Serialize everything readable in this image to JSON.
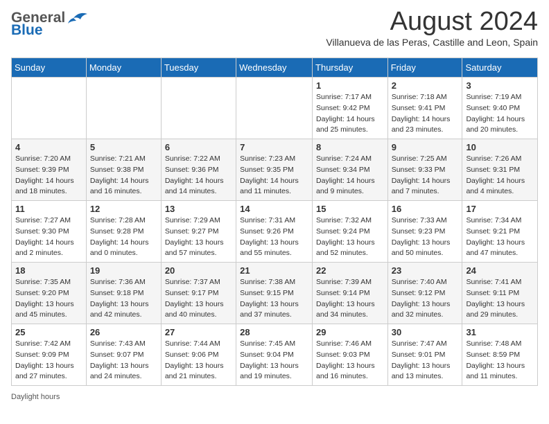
{
  "header": {
    "logo_general": "General",
    "logo_blue": "Blue",
    "month_title": "August 2024",
    "location": "Villanueva de las Peras, Castille and Leon, Spain"
  },
  "calendar": {
    "days_of_week": [
      "Sunday",
      "Monday",
      "Tuesday",
      "Wednesday",
      "Thursday",
      "Friday",
      "Saturday"
    ],
    "weeks": [
      [
        {
          "day": "",
          "info": ""
        },
        {
          "day": "",
          "info": ""
        },
        {
          "day": "",
          "info": ""
        },
        {
          "day": "",
          "info": ""
        },
        {
          "day": "1",
          "info": "Sunrise: 7:17 AM\nSunset: 9:42 PM\nDaylight: 14 hours and 25 minutes."
        },
        {
          "day": "2",
          "info": "Sunrise: 7:18 AM\nSunset: 9:41 PM\nDaylight: 14 hours and 23 minutes."
        },
        {
          "day": "3",
          "info": "Sunrise: 7:19 AM\nSunset: 9:40 PM\nDaylight: 14 hours and 20 minutes."
        }
      ],
      [
        {
          "day": "4",
          "info": "Sunrise: 7:20 AM\nSunset: 9:39 PM\nDaylight: 14 hours and 18 minutes."
        },
        {
          "day": "5",
          "info": "Sunrise: 7:21 AM\nSunset: 9:38 PM\nDaylight: 14 hours and 16 minutes."
        },
        {
          "day": "6",
          "info": "Sunrise: 7:22 AM\nSunset: 9:36 PM\nDaylight: 14 hours and 14 minutes."
        },
        {
          "day": "7",
          "info": "Sunrise: 7:23 AM\nSunset: 9:35 PM\nDaylight: 14 hours and 11 minutes."
        },
        {
          "day": "8",
          "info": "Sunrise: 7:24 AM\nSunset: 9:34 PM\nDaylight: 14 hours and 9 minutes."
        },
        {
          "day": "9",
          "info": "Sunrise: 7:25 AM\nSunset: 9:33 PM\nDaylight: 14 hours and 7 minutes."
        },
        {
          "day": "10",
          "info": "Sunrise: 7:26 AM\nSunset: 9:31 PM\nDaylight: 14 hours and 4 minutes."
        }
      ],
      [
        {
          "day": "11",
          "info": "Sunrise: 7:27 AM\nSunset: 9:30 PM\nDaylight: 14 hours and 2 minutes."
        },
        {
          "day": "12",
          "info": "Sunrise: 7:28 AM\nSunset: 9:28 PM\nDaylight: 14 hours and 0 minutes."
        },
        {
          "day": "13",
          "info": "Sunrise: 7:29 AM\nSunset: 9:27 PM\nDaylight: 13 hours and 57 minutes."
        },
        {
          "day": "14",
          "info": "Sunrise: 7:31 AM\nSunset: 9:26 PM\nDaylight: 13 hours and 55 minutes."
        },
        {
          "day": "15",
          "info": "Sunrise: 7:32 AM\nSunset: 9:24 PM\nDaylight: 13 hours and 52 minutes."
        },
        {
          "day": "16",
          "info": "Sunrise: 7:33 AM\nSunset: 9:23 PM\nDaylight: 13 hours and 50 minutes."
        },
        {
          "day": "17",
          "info": "Sunrise: 7:34 AM\nSunset: 9:21 PM\nDaylight: 13 hours and 47 minutes."
        }
      ],
      [
        {
          "day": "18",
          "info": "Sunrise: 7:35 AM\nSunset: 9:20 PM\nDaylight: 13 hours and 45 minutes."
        },
        {
          "day": "19",
          "info": "Sunrise: 7:36 AM\nSunset: 9:18 PM\nDaylight: 13 hours and 42 minutes."
        },
        {
          "day": "20",
          "info": "Sunrise: 7:37 AM\nSunset: 9:17 PM\nDaylight: 13 hours and 40 minutes."
        },
        {
          "day": "21",
          "info": "Sunrise: 7:38 AM\nSunset: 9:15 PM\nDaylight: 13 hours and 37 minutes."
        },
        {
          "day": "22",
          "info": "Sunrise: 7:39 AM\nSunset: 9:14 PM\nDaylight: 13 hours and 34 minutes."
        },
        {
          "day": "23",
          "info": "Sunrise: 7:40 AM\nSunset: 9:12 PM\nDaylight: 13 hours and 32 minutes."
        },
        {
          "day": "24",
          "info": "Sunrise: 7:41 AM\nSunset: 9:11 PM\nDaylight: 13 hours and 29 minutes."
        }
      ],
      [
        {
          "day": "25",
          "info": "Sunrise: 7:42 AM\nSunset: 9:09 PM\nDaylight: 13 hours and 27 minutes."
        },
        {
          "day": "26",
          "info": "Sunrise: 7:43 AM\nSunset: 9:07 PM\nDaylight: 13 hours and 24 minutes."
        },
        {
          "day": "27",
          "info": "Sunrise: 7:44 AM\nSunset: 9:06 PM\nDaylight: 13 hours and 21 minutes."
        },
        {
          "day": "28",
          "info": "Sunrise: 7:45 AM\nSunset: 9:04 PM\nDaylight: 13 hours and 19 minutes."
        },
        {
          "day": "29",
          "info": "Sunrise: 7:46 AM\nSunset: 9:03 PM\nDaylight: 13 hours and 16 minutes."
        },
        {
          "day": "30",
          "info": "Sunrise: 7:47 AM\nSunset: 9:01 PM\nDaylight: 13 hours and 13 minutes."
        },
        {
          "day": "31",
          "info": "Sunrise: 7:48 AM\nSunset: 8:59 PM\nDaylight: 13 hours and 11 minutes."
        }
      ]
    ]
  },
  "footer": {
    "text": "Daylight hours"
  }
}
